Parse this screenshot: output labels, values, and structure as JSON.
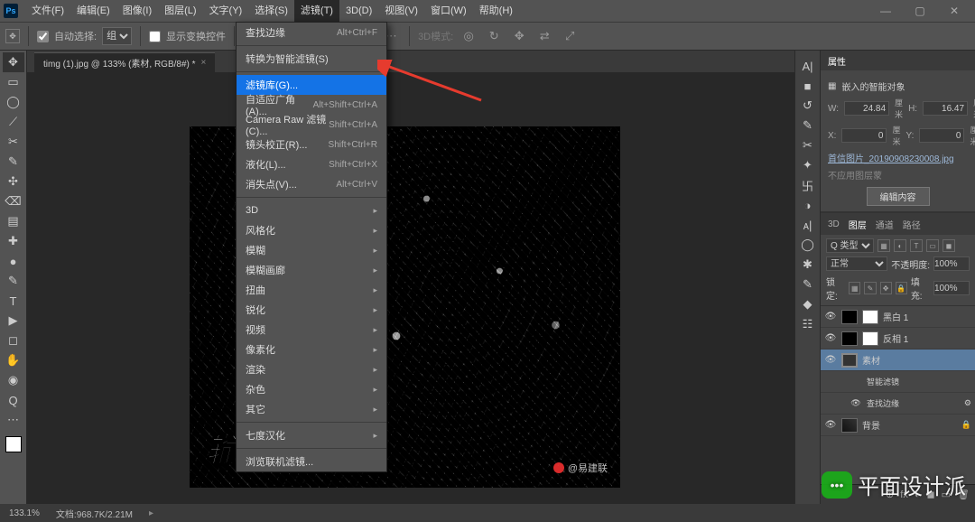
{
  "menubar": [
    "文件(F)",
    "编辑(E)",
    "图像(I)",
    "图层(L)",
    "文字(Y)",
    "选择(S)",
    "滤镜(T)",
    "3D(D)",
    "视图(V)",
    "窗口(W)",
    "帮助(H)"
  ],
  "menubar_open_index": 6,
  "win_controls": [
    "—",
    "▢",
    "✕"
  ],
  "options": {
    "auto_select": "自动选择:",
    "auto_select_value": "组",
    "show_transform": "显示变换控件",
    "mode3d": "3D模式:"
  },
  "doc_tab": "timg (1).jpg @ 133% (素材, RGB/8#) *",
  "dropdown_items": [
    {
      "t": "查找边缘",
      "sc": "Alt+Ctrl+F"
    },
    {
      "sep": true
    },
    {
      "t": "转换为智能滤镜(S)"
    },
    {
      "sep": true
    },
    {
      "t": "滤镜库(G)...",
      "hi": true
    },
    {
      "t": "自适应广角(A)...",
      "sc": "Alt+Shift+Ctrl+A"
    },
    {
      "t": "Camera Raw 滤镜(C)...",
      "sc": "Shift+Ctrl+A"
    },
    {
      "t": "镜头校正(R)...",
      "sc": "Shift+Ctrl+R"
    },
    {
      "t": "液化(L)...",
      "sc": "Shift+Ctrl+X"
    },
    {
      "t": "消失点(V)...",
      "sc": "Alt+Ctrl+V"
    },
    {
      "sep": true
    },
    {
      "t": "3D",
      "sub": true
    },
    {
      "t": "风格化",
      "sub": true
    },
    {
      "t": "模糊",
      "sub": true
    },
    {
      "t": "模糊画廊",
      "sub": true
    },
    {
      "t": "扭曲",
      "sub": true
    },
    {
      "t": "锐化",
      "sub": true
    },
    {
      "t": "视频",
      "sub": true
    },
    {
      "t": "像素化",
      "sub": true
    },
    {
      "t": "渲染",
      "sub": true
    },
    {
      "t": "杂色",
      "sub": true
    },
    {
      "t": "其它",
      "sub": true
    },
    {
      "sep": true
    },
    {
      "t": "七度汉化",
      "sub": true
    },
    {
      "sep": true
    },
    {
      "t": "浏览联机滤镜..."
    }
  ],
  "canvas_text": "输，一起扛",
  "canvas_watermark": "@易建联",
  "properties": {
    "panel_title": "属性",
    "title": "嵌入的智能对象",
    "w_label": "W:",
    "w_value": "24.84",
    "w_unit": "厘米",
    "h_label": "H:",
    "h_value": "16.47",
    "h_unit": "厘米",
    "x_label": "X:",
    "x_value": "0",
    "x_unit": "厘米",
    "y_label": "Y:",
    "y_value": "0",
    "y_unit": "厘米",
    "source_file": "首信图片_20190908230008.jpg",
    "convert_note": "不应用图层蒙",
    "edit_btn": "编辑内容"
  },
  "layers": {
    "tabs": [
      "3D",
      "图层",
      "通道",
      "路径"
    ],
    "tabs_active": 1,
    "kind": "Q 类型",
    "blend": "正常",
    "opacity_label": "不透明度:",
    "opacity": "100%",
    "lock_label": "锁定:",
    "fill_label": "填充:",
    "fill": "100%",
    "rows": [
      {
        "eye": true,
        "thumb": "inv",
        "mask": "white",
        "name": "黑白 1"
      },
      {
        "eye": true,
        "thumb": "inv",
        "mask": "white",
        "name": "反相 1"
      },
      {
        "eye": true,
        "thumb": "so",
        "name": "素材",
        "sel": true
      },
      {
        "eye": false,
        "indent": true,
        "name": "智能滤镜"
      },
      {
        "eye": true,
        "indent": true,
        "name": "查找边缘",
        "gear": true
      },
      {
        "eye": true,
        "thumb": "img",
        "name": "背景",
        "lock": true
      }
    ]
  },
  "footer_icons": [
    "⊕",
    "fx",
    "◐",
    "◼",
    "▭",
    "🗑"
  ],
  "statusbar": {
    "zoom": "133.1%",
    "docinfo": "文档:968.7K/2.21M"
  },
  "wechat": "平面设计派",
  "righticons": [
    "A|",
    "■",
    "↺",
    "✎",
    "✂",
    "✦",
    "卐",
    "◑",
    "ᴀ|",
    "◯",
    "✱",
    "✎",
    "◆",
    "☷"
  ],
  "tools": [
    "✥",
    "▭",
    "◯",
    "⟋",
    "✂",
    "✎",
    "✣",
    "⌫",
    "▤",
    "✚",
    "●",
    "✎",
    "T",
    "▶",
    "◻",
    "✋",
    "◉",
    "Q",
    "⋯"
  ]
}
